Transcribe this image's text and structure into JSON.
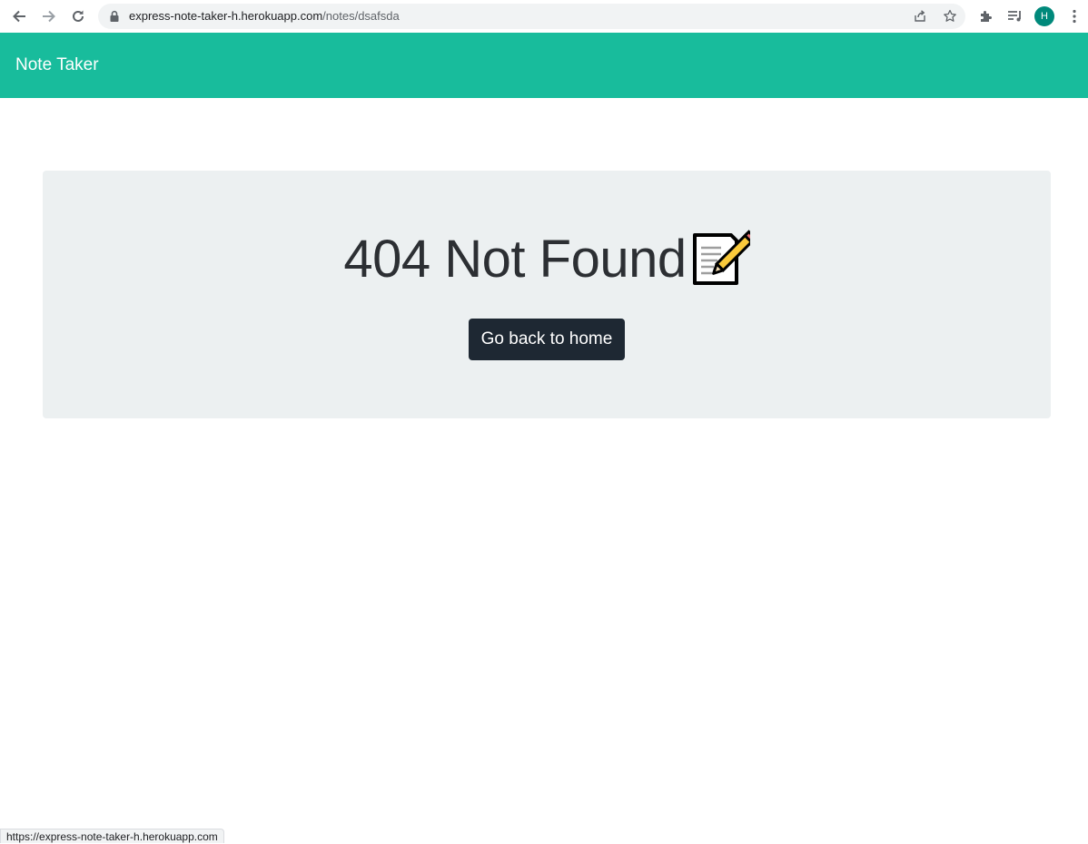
{
  "browser": {
    "url_host": "express-note-taker-h.herokuapp.com",
    "url_path": "/notes/dsafsda",
    "profile_initial": "H",
    "status_url": "https://express-note-taker-h.herokuapp.com"
  },
  "navbar": {
    "brand": "Note Taker",
    "color": "#18bc9c"
  },
  "main": {
    "heading": "404 Not Found",
    "heading_icon": "memo-icon",
    "button_label": "Go back to home"
  }
}
